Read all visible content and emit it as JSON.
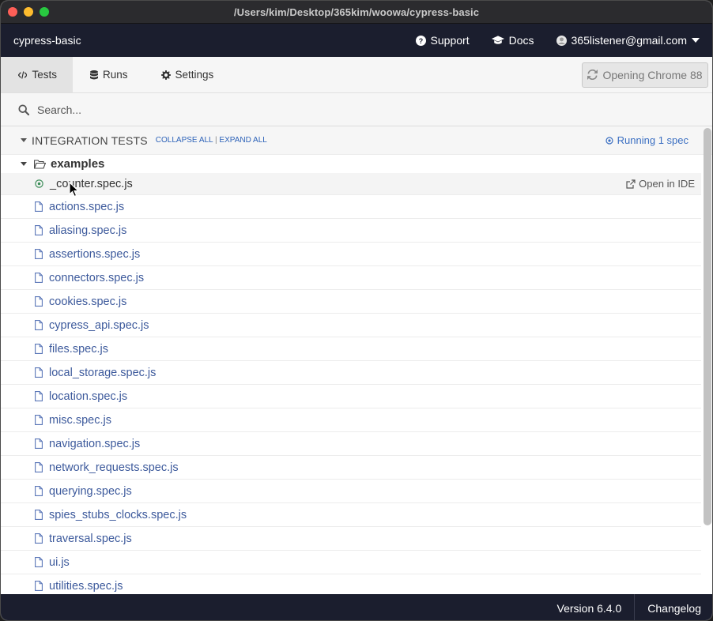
{
  "window": {
    "title_path": "/Users/kim/Desktop/365kim/woowa/cypress-basic"
  },
  "header": {
    "project_name": "cypress-basic",
    "support_label": "Support",
    "docs_label": "Docs",
    "user_email": "365listener@gmail.com"
  },
  "tabs": [
    {
      "label": "Tests",
      "icon": "code-icon",
      "active": true
    },
    {
      "label": "Runs",
      "icon": "database-icon",
      "active": false
    },
    {
      "label": "Settings",
      "icon": "gear-icon",
      "active": false
    }
  ],
  "browser_button": {
    "label": "Opening Chrome 88",
    "icon": "refresh-icon"
  },
  "search": {
    "placeholder": "Search..."
  },
  "specs": {
    "section_title": "INTEGRATION TESTS",
    "collapse_all": "COLLAPSE ALL",
    "separator": "|",
    "expand_all": "EXPAND ALL",
    "running_text": "Running 1 spec",
    "folder_name": "examples",
    "open_in_ide_label": "Open in IDE",
    "files": [
      {
        "name": "_counter.spec.js",
        "running": true
      },
      {
        "name": "actions.spec.js",
        "running": false
      },
      {
        "name": "aliasing.spec.js",
        "running": false
      },
      {
        "name": "assertions.spec.js",
        "running": false
      },
      {
        "name": "connectors.spec.js",
        "running": false
      },
      {
        "name": "cookies.spec.js",
        "running": false
      },
      {
        "name": "cypress_api.spec.js",
        "running": false
      },
      {
        "name": "files.spec.js",
        "running": false
      },
      {
        "name": "local_storage.spec.js",
        "running": false
      },
      {
        "name": "location.spec.js",
        "running": false
      },
      {
        "name": "misc.spec.js",
        "running": false
      },
      {
        "name": "navigation.spec.js",
        "running": false
      },
      {
        "name": "network_requests.spec.js",
        "running": false
      },
      {
        "name": "querying.spec.js",
        "running": false
      },
      {
        "name": "spies_stubs_clocks.spec.js",
        "running": false
      },
      {
        "name": "traversal.spec.js",
        "running": false
      },
      {
        "name": "ui.js",
        "running": false
      },
      {
        "name": "utilities.spec.js",
        "running": false
      }
    ]
  },
  "footer": {
    "version": "Version 6.4.0",
    "changelog": "Changelog"
  },
  "colors": {
    "header_bg": "#1b1e2e",
    "link_blue": "#3d5a9c",
    "running_blue": "#3b6fc2"
  }
}
